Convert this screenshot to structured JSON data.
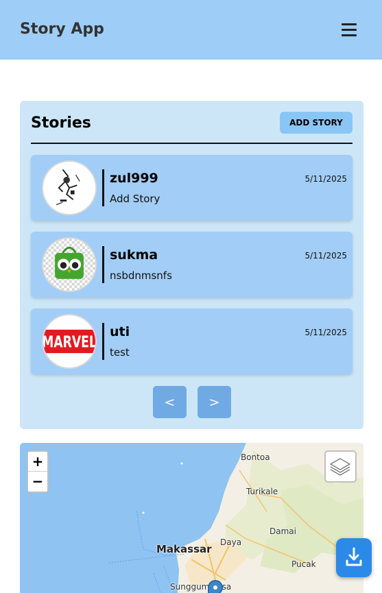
{
  "header": {
    "title": "Story App",
    "menu_icon": "hamburger-menu-icon"
  },
  "stories": {
    "title": "Stories",
    "add_button_label": "ADD STORY",
    "items": [
      {
        "name": "zul999",
        "description": "Add Story",
        "date": "5/11/2025",
        "avatar_icon": "sketch-figure-image"
      },
      {
        "name": "sukma",
        "description": "nsbdnmsnfs",
        "date": "5/11/2025",
        "avatar_icon": "green-owl-bag-image"
      },
      {
        "name": "uti",
        "description": "test",
        "date": "5/11/2025",
        "avatar_icon": "marvel-logo-image"
      }
    ],
    "prev_label": "<",
    "next_label": ">"
  },
  "map": {
    "zoom_in_label": "+",
    "zoom_out_label": "−",
    "layers_icon": "layers-icon",
    "places": [
      "Bontoa",
      "Turikale",
      "Damai",
      "Makassar",
      "Daya",
      "Pucak",
      "Sungguminasa"
    ]
  },
  "download_icon": "download-icon",
  "colors": {
    "header": "#9ecdf7",
    "panel": "#cde6f7",
    "card": "#a2cdf6",
    "page_button": "#6faae5",
    "download_button": "#2b8ae8"
  }
}
